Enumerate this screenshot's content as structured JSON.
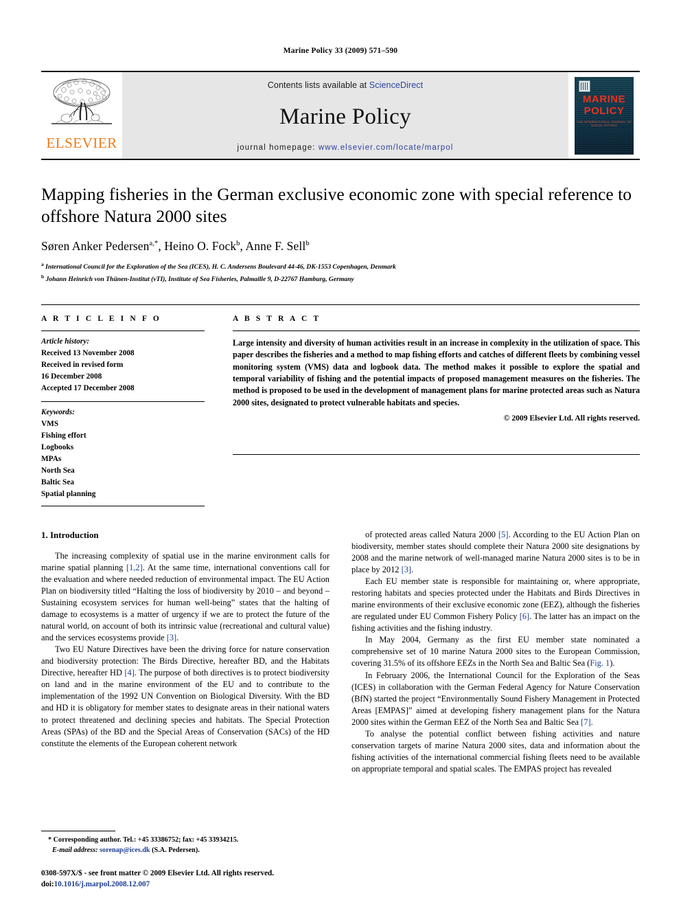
{
  "running_head": "Marine Policy 33 (2009) 571–590",
  "banner": {
    "publisher_name": "ELSEVIER",
    "contents_prefix": "Contents lists available at ",
    "contents_link": "ScienceDirect",
    "journal_name": "Marine Policy",
    "homepage_prefix": "journal homepage: ",
    "homepage_url": "www.elsevier.com/locate/marpol",
    "cover_title_line1": "MARINE",
    "cover_title_line2": "POLICY",
    "cover_subtitle": "THE INTERNATIONAL JOURNAL OF OCEAN AFFAIRS",
    "link_color": "#2b3f9e",
    "cover_text_color": "#e8321e",
    "elsevier_orange": "#F07B19"
  },
  "article": {
    "title": "Mapping fisheries in the German exclusive economic zone with special reference to offshore Natura 2000 sites",
    "authors_html": "Søren Anker Pedersen<sup>a,</sup><sup>*</sup>, Heino O. Fock<sup>b</sup>, Anne F. Sell<sup>b</sup>",
    "affiliation_a": "International Council for the Exploration of the Sea (ICES), H. C. Andersens Boulevard 44-46, DK-1553 Copenhagen, Denmark",
    "affiliation_b": "Johann Heinrich von Thünen-Institut (vTI), Institute of Sea Fisheries, Palmaille 9, D-22767 Hamburg, Germany"
  },
  "article_info": {
    "heading": "A R T I C L E   I N F O",
    "history_label": "Article history:",
    "history": [
      "Received 13 November 2008",
      "Received in revised form",
      "16 December 2008",
      "Accepted 17 December 2008"
    ],
    "keywords_label": "Keywords:",
    "keywords": [
      "VMS",
      "Fishing effort",
      "Logbooks",
      "MPAs",
      "North Sea",
      "Baltic Sea",
      "Spatial planning"
    ]
  },
  "abstract": {
    "heading": "A B S T R A C T",
    "text": "Large intensity and diversity of human activities result in an increase in complexity in the utilization of space. This paper describes the fisheries and a method to map fishing efforts and catches of different fleets by combining vessel monitoring system (VMS) data and logbook data. The method makes it possible to explore the spatial and temporal variability of fishing and the potential impacts of proposed management measures on the fisheries. The method is proposed to be used in the development of management plans for marine protected areas such as Natura 2000 sites, designated to protect vulnerable habitats and species.",
    "copyright": "© 2009 Elsevier Ltd. All rights reserved."
  },
  "body": {
    "section_number_title": "1.  Introduction",
    "left_paragraphs": [
      "The increasing complexity of spatial use in the marine environment calls for marine spatial planning [1,2]. At the same time, international conventions call for the evaluation and where needed reduction of environmental impact. The EU Action Plan on biodiversity titled “Halting the loss of biodiversity by 2010 – and beyond – Sustaining ecosystem services for human well-being” states that the halting of damage to ecosystems is a matter of urgency if we are to protect the future of the natural world, on account of both its intrinsic value (recreational and cultural value) and the services ecosystems provide [3].",
      "Two EU Nature Directives have been the driving force for nature conservation and biodiversity protection: The Birds Directive, hereafter BD, and the Habitats Directive, hereafter HD [4]. The purpose of both directives is to protect biodiversity on land and in the marine environment of the EU and to contribute to the implementation of the 1992 UN Convention on Biological Diversity. With the BD and HD it is obligatory for member states to designate areas in their national waters to protect threatened and declining species and habitats. The Special Protection Areas (SPAs) of the BD and the Special Areas of Conservation (SACs) of the HD constitute the elements of the European coherent network"
    ],
    "right_paragraphs": [
      "of protected areas called Natura 2000 [5]. According to the EU Action Plan on biodiversity, member states should complete their Natura 2000 site designations by 2008 and the marine network of well-managed marine Natura 2000 sites is to be in place by 2012 [3].",
      "Each EU member state is responsible for maintaining or, where appropriate, restoring habitats and species protected under the Habitats and Birds Directives in marine environments of their exclusive economic zone (EEZ), although the fisheries are regulated under EU Common Fishery Policy [6]. The latter has an impact on the fishing activities and the fishing industry.",
      "In May 2004, Germany as the first EU member state nominated a comprehensive set of 10 marine Natura 2000 sites to the European Commission, covering 31.5% of its offshore EEZs in the North Sea and Baltic Sea (Fig. 1).",
      "In February 2006, the International Council for the Exploration of the Seas (ICES) in collaboration with the German Federal Agency for Nature Conservation (BfN) started the project “Environmentally Sound Fishery Management in Protected Areas [EMPAS]” aimed at developing fishery management plans for the Natura 2000 sites within the German EEZ of the North Sea and Baltic Sea [7].",
      "To analyse the potential conflict between fishing activities and nature conservation targets of marine Natura 2000 sites, data and information about the fishing activities of the international commercial fishing fleets need to be available on appropriate temporal and spatial scales. The EMPAS project has revealed"
    ]
  },
  "footnotes": {
    "corresponding": "* Corresponding author. Tel.: +45 33386752; fax: +45 33934215.",
    "email_label": "E-mail address:",
    "email_value": "sorenap@ices.dk",
    "email_suffix": " (S.A. Pedersen).",
    "issn_line": "0308-597X/$ - see front matter © 2009 Elsevier Ltd. All rights reserved.",
    "doi_label": "doi:",
    "doi_value": "10.1016/j.marpol.2008.12.007"
  }
}
